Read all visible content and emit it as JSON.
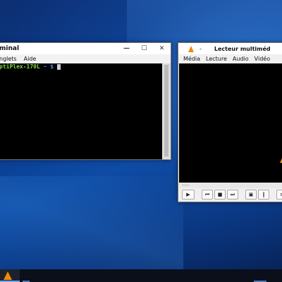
{
  "terminal": {
    "title": "minal",
    "menu": [
      "nglets",
      "Aide"
    ],
    "prompt_host": "ptiPlex-170L",
    "prompt_path": "~",
    "prompt_symbol": "$",
    "controls": {
      "minimize": "—",
      "maximize": "☐",
      "close": "✕"
    }
  },
  "vlc": {
    "title_dash": "-",
    "title": "Lecteur multiméd",
    "menu": [
      "Média",
      "Lecture",
      "Audio",
      "Vidéo"
    ],
    "time": "--:--"
  },
  "colors": {
    "prompt_green": "#7ddc3a",
    "vlc_orange": "#f08a00",
    "taskbar": "#0a0f1a"
  }
}
